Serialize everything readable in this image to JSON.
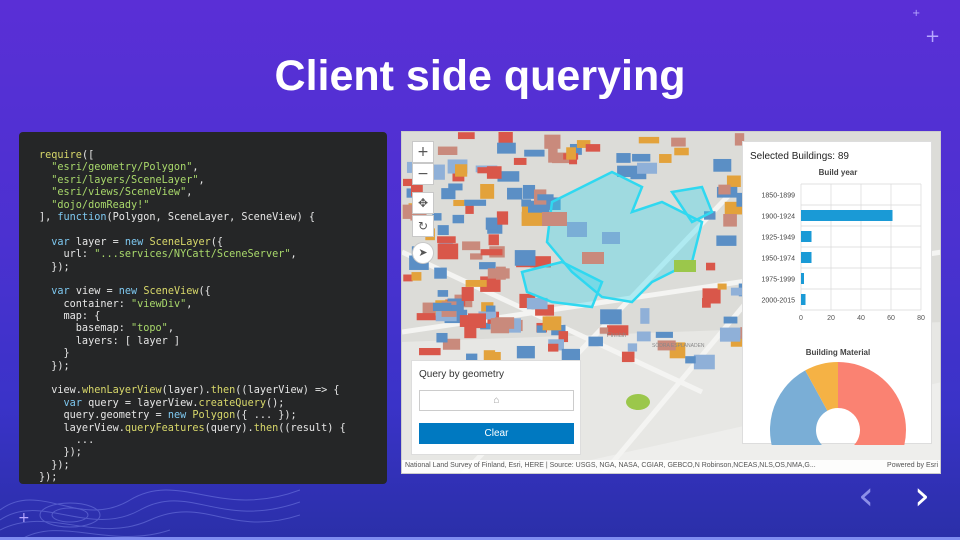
{
  "slide": {
    "title": "Client side querying"
  },
  "code": {
    "lines": [
      [
        [
          "fn",
          "require"
        ],
        [
          "plain",
          "(["
        ]
      ],
      [
        [
          "str",
          "  \"esri/geometry/Polygon\""
        ],
        [
          "plain",
          ","
        ]
      ],
      [
        [
          "str",
          "  \"esri/layers/SceneLayer\""
        ],
        [
          "plain",
          ","
        ]
      ],
      [
        [
          "str",
          "  \"esri/views/SceneView\""
        ],
        [
          "plain",
          ","
        ]
      ],
      [
        [
          "str",
          "  \"dojo/domReady!\""
        ]
      ],
      [
        [
          "plain",
          "], "
        ],
        [
          "kw",
          "function"
        ],
        [
          "plain",
          "(Polygon, SceneLayer, SceneView) {"
        ]
      ],
      [
        [
          "plain",
          ""
        ]
      ],
      [
        [
          "plain",
          "  "
        ],
        [
          "kw",
          "var"
        ],
        [
          "plain",
          " layer = "
        ],
        [
          "kw",
          "new"
        ],
        [
          "plain",
          " "
        ],
        [
          "fn",
          "SceneLayer"
        ],
        [
          "plain",
          "({"
        ]
      ],
      [
        [
          "plain",
          "    url: "
        ],
        [
          "str",
          "\"...services/NYCatt/SceneServer\""
        ],
        [
          "plain",
          ","
        ]
      ],
      [
        [
          "plain",
          "  });"
        ]
      ],
      [
        [
          "plain",
          ""
        ]
      ],
      [
        [
          "plain",
          "  "
        ],
        [
          "kw",
          "var"
        ],
        [
          "plain",
          " view = "
        ],
        [
          "kw",
          "new"
        ],
        [
          "plain",
          " "
        ],
        [
          "fn",
          "SceneView"
        ],
        [
          "plain",
          "({"
        ]
      ],
      [
        [
          "plain",
          "    container: "
        ],
        [
          "str",
          "\"viewDiv\""
        ],
        [
          "plain",
          ","
        ]
      ],
      [
        [
          "plain",
          "    map: {"
        ]
      ],
      [
        [
          "plain",
          "      basemap: "
        ],
        [
          "str",
          "\"topo\""
        ],
        [
          "plain",
          ","
        ]
      ],
      [
        [
          "plain",
          "      layers: [ layer ]"
        ]
      ],
      [
        [
          "plain",
          "    }"
        ]
      ],
      [
        [
          "plain",
          "  });"
        ]
      ],
      [
        [
          "plain",
          ""
        ]
      ],
      [
        [
          "plain",
          "  view."
        ],
        [
          "fn",
          "whenLayerView"
        ],
        [
          "plain",
          "(layer)."
        ],
        [
          "fn",
          "then"
        ],
        [
          "plain",
          "((layerView) => {"
        ]
      ],
      [
        [
          "plain",
          "    "
        ],
        [
          "kw",
          "var"
        ],
        [
          "plain",
          " query = layerView."
        ],
        [
          "fn",
          "createQuery"
        ],
        [
          "plain",
          "();"
        ]
      ],
      [
        [
          "plain",
          "    query.geometry = "
        ],
        [
          "kw",
          "new"
        ],
        [
          "plain",
          " "
        ],
        [
          "fn",
          "Polygon"
        ],
        [
          "plain",
          "({ ... });"
        ]
      ],
      [
        [
          "plain",
          "    layerView."
        ],
        [
          "fn",
          "queryFeatures"
        ],
        [
          "plain",
          "(query)."
        ],
        [
          "fn",
          "then"
        ],
        [
          "plain",
          "((result) {"
        ]
      ],
      [
        [
          "plain",
          "      ..."
        ]
      ],
      [
        [
          "plain",
          "    });"
        ]
      ],
      [
        [
          "plain",
          "  });"
        ]
      ],
      [
        [
          "plain",
          "});"
        ]
      ]
    ]
  },
  "map": {
    "zoom_in": "+",
    "zoom_out": "−",
    "query_box": {
      "title": "Query by geometry",
      "input_icon": "polygon-draw-icon",
      "input_glyph": "⌂",
      "clear_label": "Clear"
    },
    "stats": {
      "title": "Selected Buildings: 89",
      "bar_chart_title": "Build year",
      "pie_chart_title": "Building Material"
    },
    "attribution": "National Land Survey of Finland, Esri, HERE | Source: USGS, NGA, NASA, CGIAR, GEBCO,N Robinson,NCEAS,NLS,OS,NMA,G...",
    "powered_by": "Powered by Esri"
  },
  "chart_data": [
    {
      "type": "bar",
      "orientation": "horizontal",
      "title": "Build year",
      "categories": [
        "1850-1899",
        "1900-1924",
        "1925-1949",
        "1950-1974",
        "1975-1999",
        "2000-2015"
      ],
      "values": [
        0,
        61,
        7,
        7,
        2,
        3
      ],
      "xlim": [
        0,
        80
      ],
      "xticks": [
        0,
        20,
        40,
        60,
        80
      ],
      "color": "#1a9ad6",
      "grid": true
    },
    {
      "type": "pie",
      "title": "Building Material",
      "donut": true,
      "slices": [
        {
          "value": 52,
          "color": "#7aaed6"
        },
        {
          "value": 40,
          "color": "#fa8272"
        },
        {
          "value": 8,
          "color": "#f5b245"
        }
      ]
    }
  ],
  "nav": {
    "prev": "‹",
    "next": "›",
    "prev_icon": "chevron-left-icon",
    "next_icon": "chevron-right-icon"
  },
  "colors": {
    "accent": "#0079c1",
    "bar": "#1a9ad6",
    "highlight": "#2fd8f0"
  }
}
